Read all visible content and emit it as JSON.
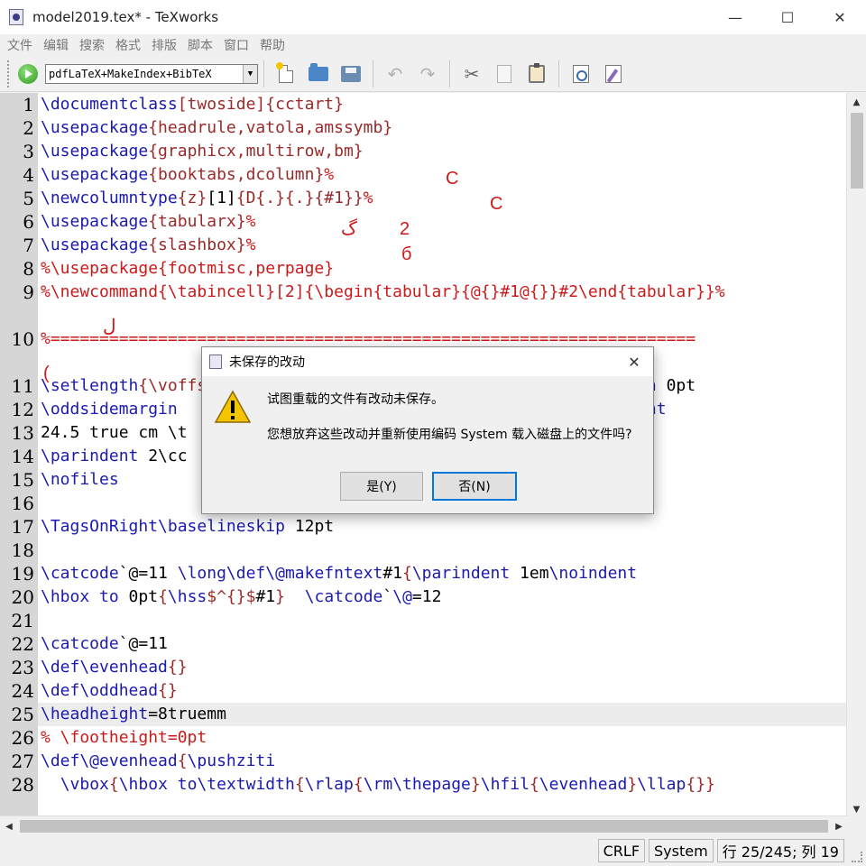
{
  "window": {
    "title": "model2019.tex* - TeXworks"
  },
  "menu": [
    "文件",
    "编辑",
    "搜索",
    "格式",
    "排版",
    "脚本",
    "窗口",
    "帮助"
  ],
  "toolbar": {
    "engine": "pdfLaTeX+MakeIndex+BibTeX",
    "icons": [
      "run-icon",
      "new-document-icon",
      "open-folder-icon",
      "save-icon",
      "undo-icon",
      "redo-icon",
      "cut-icon",
      "copy-icon",
      "paste-icon",
      "find-icon",
      "replace-icon"
    ]
  },
  "editor": {
    "current_line": 25,
    "lines": [
      {
        "n": "1",
        "segments": [
          [
            "cmd",
            "\\documentclass"
          ],
          [
            "arg",
            "[twoside]"
          ],
          [
            "arg",
            "{cctart}"
          ]
        ]
      },
      {
        "n": "2",
        "segments": [
          [
            "cmd",
            "\\usepackage"
          ],
          [
            "arg",
            "{headrule,vatola,amssymb}"
          ]
        ]
      },
      {
        "n": "3",
        "segments": [
          [
            "cmd",
            "\\usepackage"
          ],
          [
            "arg",
            "{graphicx,multirow,bm}"
          ]
        ]
      },
      {
        "n": "4",
        "segments": [
          [
            "cmd",
            "\\usepackage"
          ],
          [
            "arg",
            "{booktabs,dcolumn}"
          ],
          [
            "cmt",
            "%"
          ]
        ]
      },
      {
        "n": "5",
        "segments": [
          [
            "cmd",
            "\\newcolumntype"
          ],
          [
            "arg",
            "{z}"
          ],
          [
            "plain",
            "[1]"
          ],
          [
            "arg",
            "{D{.}{.}{#1}}"
          ],
          [
            "cmt",
            "%"
          ]
        ]
      },
      {
        "n": "6",
        "segments": [
          [
            "cmd",
            "\\usepackage"
          ],
          [
            "arg",
            "{tabularx}"
          ],
          [
            "cmt",
            "%"
          ]
        ]
      },
      {
        "n": "7",
        "segments": [
          [
            "cmd",
            "\\usepackage"
          ],
          [
            "arg",
            "{slashbox}"
          ],
          [
            "cmt",
            "%"
          ]
        ]
      },
      {
        "n": "8",
        "segments": [
          [
            "cmt",
            "%\\usepackage{footmisc,perpage}"
          ]
        ]
      },
      {
        "n": "9",
        "segments": [
          [
            "cmt",
            "%\\newcommand{\\tabincell}[2]{\\begin{tabular}{@{}#1@{}}#2\\end{tabular}}%"
          ]
        ],
        "tall": true
      },
      {
        "n": "10",
        "segments": [
          [
            "cmt",
            "%=================================================================="
          ]
        ],
        "tall": true
      },
      {
        "n": "11",
        "segments": [
          [
            "cmd",
            "\\setlength"
          ],
          [
            "arg",
            "{\\voffset}"
          ],
          [
            "plain",
            "                                          "
          ],
          [
            "cmd",
            "n"
          ],
          [
            "plain",
            " 0pt"
          ]
        ]
      },
      {
        "n": "12",
        "segments": [
          [
            "cmd",
            "\\oddsidemargin"
          ],
          [
            "plain",
            "                                          "
          ],
          [
            "cmd",
            "xtheight"
          ]
        ]
      },
      {
        "n": "13",
        "segments": [
          [
            "plain",
            "24.5 true cm \\t"
          ]
        ]
      },
      {
        "n": "14",
        "segments": [
          [
            "cmd",
            "\\parindent"
          ],
          [
            "plain",
            " 2\\cc"
          ]
        ]
      },
      {
        "n": "15",
        "segments": [
          [
            "cmd",
            "\\nofiles"
          ]
        ]
      },
      {
        "n": "16",
        "segments": []
      },
      {
        "n": "17",
        "segments": [
          [
            "cmd",
            "\\TagsOnRight\\baselineskip"
          ],
          [
            "plain",
            " 12pt"
          ]
        ]
      },
      {
        "n": "18",
        "segments": []
      },
      {
        "n": "19",
        "segments": [
          [
            "cmd",
            "\\catcode"
          ],
          [
            "plain",
            "`@=11 "
          ],
          [
            "cmd",
            "\\long\\def\\@makefntext"
          ],
          [
            "plain",
            "#1"
          ],
          [
            "arg",
            "{"
          ],
          [
            "cmd",
            "\\parindent"
          ],
          [
            "plain",
            " 1em"
          ],
          [
            "cmd",
            "\\noindent"
          ]
        ]
      },
      {
        "n": "20",
        "segments": [
          [
            "cmd",
            "\\hbox"
          ],
          [
            "plain",
            " "
          ],
          [
            "cmd",
            "to"
          ],
          [
            "plain",
            " 0pt"
          ],
          [
            "arg",
            "{"
          ],
          [
            "cmd",
            "\\hss"
          ],
          [
            "arg",
            "$^{}$"
          ],
          [
            "plain",
            "#1"
          ],
          [
            "arg",
            "}"
          ],
          [
            "plain",
            "  "
          ],
          [
            "cmd",
            "\\catcode"
          ],
          [
            "plain",
            "`"
          ],
          [
            "cmd",
            "\\@"
          ],
          [
            "plain",
            "=12"
          ]
        ]
      },
      {
        "n": "21",
        "segments": []
      },
      {
        "n": "22",
        "segments": [
          [
            "cmd",
            "\\catcode"
          ],
          [
            "plain",
            "`@=11"
          ]
        ]
      },
      {
        "n": "23",
        "segments": [
          [
            "cmd",
            "\\def\\evenhead"
          ],
          [
            "arg",
            "{}"
          ]
        ]
      },
      {
        "n": "24",
        "segments": [
          [
            "cmd",
            "\\def\\oddhead"
          ],
          [
            "arg",
            "{}"
          ]
        ]
      },
      {
        "n": "25",
        "segments": [
          [
            "cmd",
            "\\headheight"
          ],
          [
            "plain",
            "=8truemm"
          ]
        ]
      },
      {
        "n": "26",
        "segments": [
          [
            "cmt",
            "% \\footheight=0pt"
          ]
        ]
      },
      {
        "n": "27",
        "segments": [
          [
            "cmd",
            "\\def\\@evenhead"
          ],
          [
            "arg",
            "{"
          ],
          [
            "cmd",
            "\\pushziti"
          ]
        ]
      },
      {
        "n": "28",
        "segments": [
          [
            "plain",
            "  "
          ],
          [
            "cmd",
            "\\vbox"
          ],
          [
            "arg",
            "{"
          ],
          [
            "cmd",
            "\\hbox"
          ],
          [
            "plain",
            " "
          ],
          [
            "cmd",
            "to"
          ],
          [
            "cmd",
            "\\textwidth"
          ],
          [
            "arg",
            "{"
          ],
          [
            "cmd",
            "\\rlap"
          ],
          [
            "arg",
            "{"
          ],
          [
            "cmd",
            "\\rm\\thepage"
          ],
          [
            "arg",
            "}"
          ],
          [
            "cmd",
            "\\hfil"
          ],
          [
            "arg",
            "{"
          ],
          [
            "cmd",
            "\\evenhead"
          ],
          [
            "arg",
            "}"
          ],
          [
            "cmd",
            "\\llap"
          ],
          [
            "arg",
            "{}}"
          ]
        ]
      }
    ]
  },
  "status": {
    "line_ending": "CRLF",
    "encoding": "System",
    "position": "行 25/245; 列 19"
  },
  "dialog": {
    "title": "未保存的改动",
    "message": "试图重载的文件有改动未保存。",
    "detail": "您想放弃这些改动并重新使用编码 System 载入磁盘上的文件吗?",
    "yes_label": "是(Y)",
    "no_label": "否(N)"
  }
}
